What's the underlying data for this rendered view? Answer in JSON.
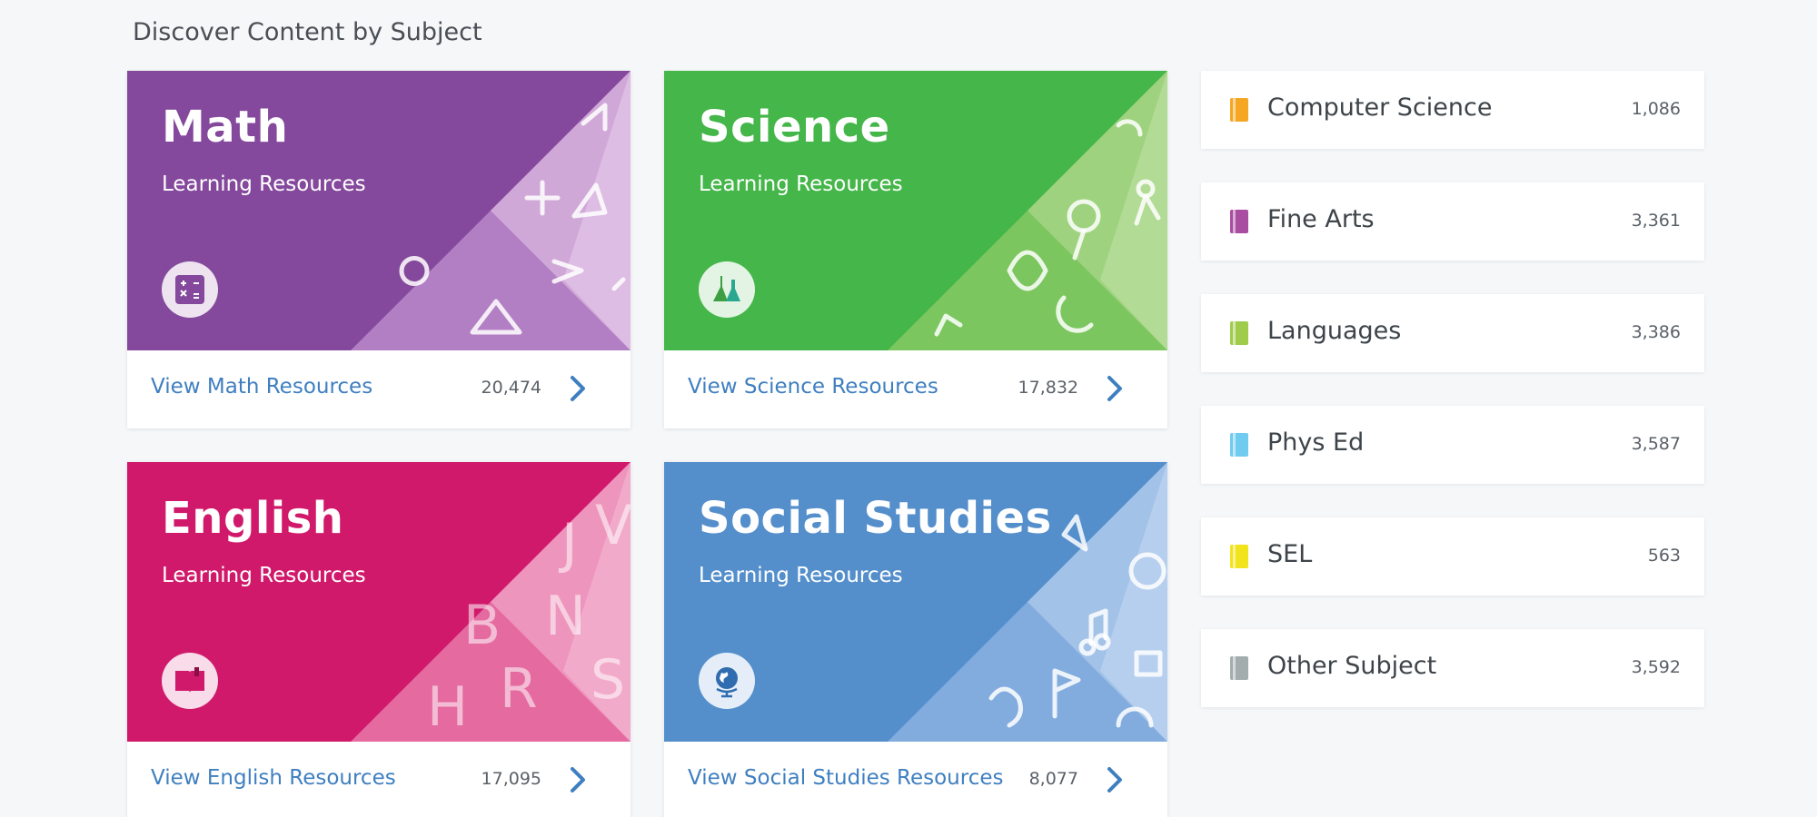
{
  "page": {
    "section_title": "Discover Content by Subject"
  },
  "cards": [
    {
      "title": "Math",
      "subtitle": "Learning Resources",
      "link": "View Math Resources",
      "count": "20,474",
      "color": "#84499c",
      "icon": "calculator-icon"
    },
    {
      "title": "Science",
      "subtitle": "Learning Resources",
      "link": "View Science Resources",
      "count": "17,832",
      "color": "#45b649",
      "icon": "flask-icon"
    },
    {
      "title": "English",
      "subtitle": "Learning Resources",
      "link": "View English Resources",
      "count": "17,095",
      "color": "#d0196a",
      "icon": "book-icon"
    },
    {
      "title": "Social Studies",
      "subtitle": "Learning Resources",
      "link": "View Social Studies Resources",
      "count": "8,077",
      "color": "#548fcc",
      "icon": "globe-icon"
    }
  ],
  "subjects": [
    {
      "label": "Computer Science",
      "count": "1,086",
      "color": "#f5a623",
      "icon": "book-icon"
    },
    {
      "label": "Fine Arts",
      "count": "3,361",
      "color": "#a84da0",
      "icon": "book-icon"
    },
    {
      "label": "Languages",
      "count": "3,386",
      "color": "#9fcc4b",
      "icon": "book-icon"
    },
    {
      "label": "Phys Ed",
      "count": "3,587",
      "color": "#6fcbf0",
      "icon": "book-icon"
    },
    {
      "label": "SEL",
      "count": "563",
      "color": "#f1e31c",
      "icon": "book-icon"
    },
    {
      "label": "Other Subject",
      "count": "3,592",
      "color": "#a3adad",
      "icon": "book-icon"
    }
  ]
}
